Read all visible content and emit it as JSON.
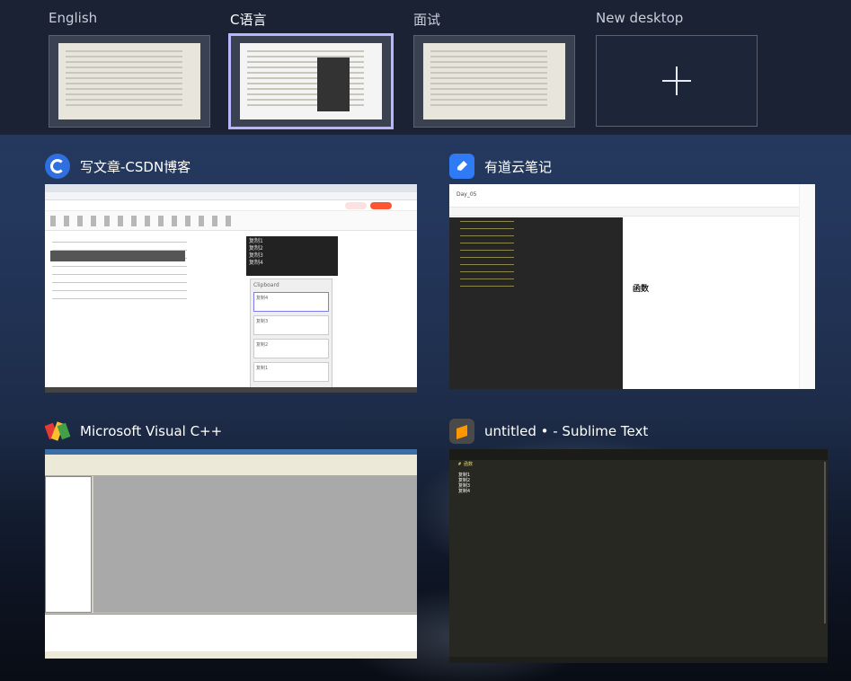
{
  "desktops": [
    {
      "label": "English",
      "active": false
    },
    {
      "label": "C语言",
      "active": true
    },
    {
      "label": "面试",
      "active": false
    }
  ],
  "new_desktop": {
    "label": "New desktop",
    "icon": "plus-icon"
  },
  "windows": [
    {
      "title": "写文章-CSDN博客",
      "icon": "csdn-icon",
      "clip_dark": [
        "复制1",
        "复制2",
        "复制3",
        "复制4"
      ],
      "clipboard_title": "Clipboard",
      "clip_cards": [
        "复制4",
        "复制3",
        "复制2",
        "复制1"
      ]
    },
    {
      "title": "有道云笔记",
      "icon": "youdao-note-icon",
      "doc_name": "Day_05",
      "heading": "函数"
    },
    {
      "title": "Microsoft Visual C++",
      "icon": "visual-cpp-icon"
    },
    {
      "title": "untitled • - Sublime Text",
      "icon": "sublime-text-icon",
      "code_title": "# 函数",
      "code_lines": [
        "复制1",
        "复制2",
        "复制3",
        "复制4"
      ]
    }
  ],
  "colors": {
    "active_desktop_border": "#b9b6ff",
    "csdn_brand": "#2f6fe0",
    "youdao_brand": "#2f7bf6",
    "sublime_accent": "#ff9800"
  }
}
